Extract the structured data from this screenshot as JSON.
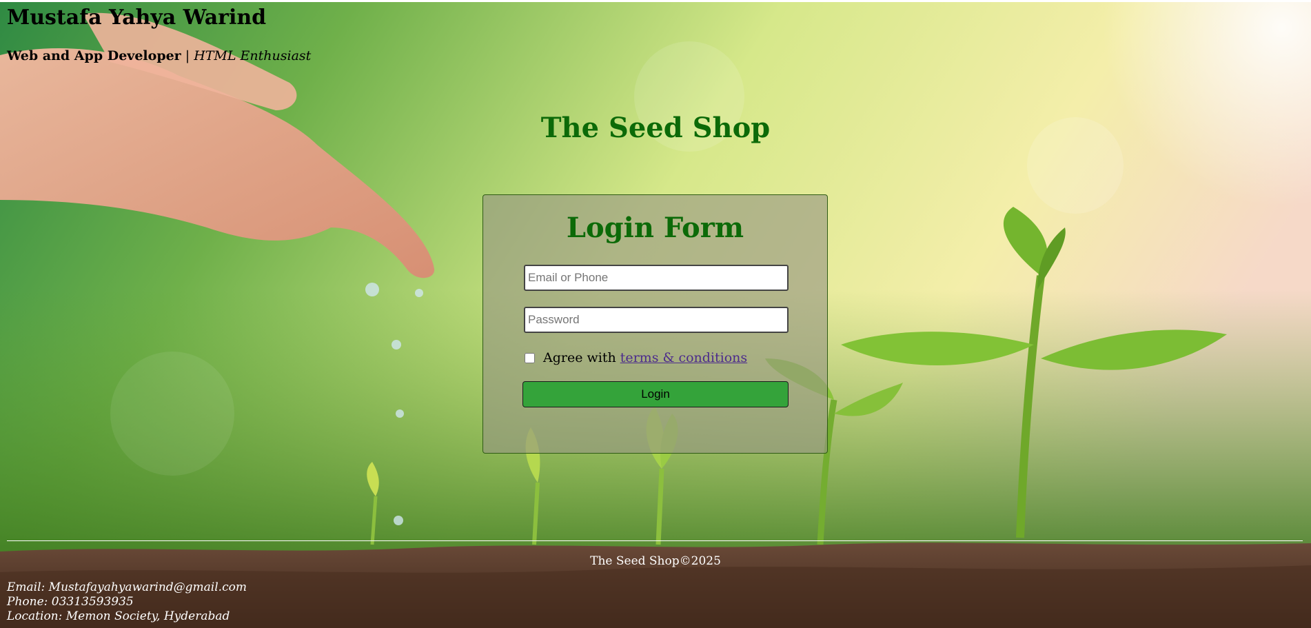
{
  "header": {
    "author_name": "Mustafa Yahya Warind",
    "role": "Web and App Developer",
    "separator": " | ",
    "tagline": "HTML Enthusiast"
  },
  "page": {
    "title": "The Seed Shop"
  },
  "login": {
    "title": "Login Form",
    "email_placeholder": "Email or Phone",
    "email_value": "",
    "password_placeholder": "Password",
    "password_value": "",
    "agree_text": "Agree with",
    "terms_link": "terms & conditions",
    "agree_checked": false,
    "button_label": "Login"
  },
  "footer": {
    "copyright": "The Seed Shop©2025",
    "email": "Email: Mustafayahyawarind@gmail.com",
    "phone": "Phone: 03313593935",
    "location": "Location: Memon Society, Hyderabad"
  },
  "colors": {
    "title_green": "#0c6a08",
    "button_green": "#34a33a",
    "link_purple": "#4b2a8c"
  }
}
